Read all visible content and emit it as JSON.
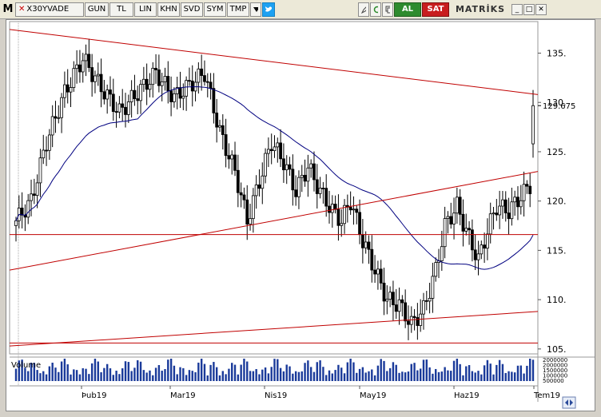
{
  "toolbar": {
    "logo": "M",
    "symbol": "X30YVADE",
    "buttons": [
      "GUN",
      "TL",
      "LIN",
      "KHN",
      "SVD",
      "SYM",
      "TMP"
    ],
    "dropdown_icon": "triangle-down-icon",
    "twitter_icon": "twitter-icon",
    "buy_label": "AL",
    "sell_label": "SAT",
    "brand": "MATRİKS"
  },
  "chart_data": {
    "type": "candlestick",
    "symbol": "X30YVADE",
    "y_ticks": [
      135,
      130,
      125,
      120,
      115,
      110,
      105
    ],
    "y_tick_labels": [
      "135.",
      "130.",
      "125.",
      "120.",
      "115.",
      "110.",
      "105."
    ],
    "ylim": [
      104.5,
      138.2
    ],
    "last_price_label": "129.675",
    "last_price": 129.675,
    "x_labels": [
      "Þub19",
      "Mar19",
      "Nis19",
      "May19",
      "Haz19",
      "Tem19"
    ],
    "volume_label": "Volume",
    "volume_tick_labels": [
      "2000000",
      "2000000",
      "1500000",
      "1000000",
      "500000"
    ],
    "colors": {
      "up": "#ffffff",
      "down": "#000000",
      "trendline": "#c00000",
      "moving_average": "#000080",
      "volume": "#1a3a9a"
    }
  }
}
